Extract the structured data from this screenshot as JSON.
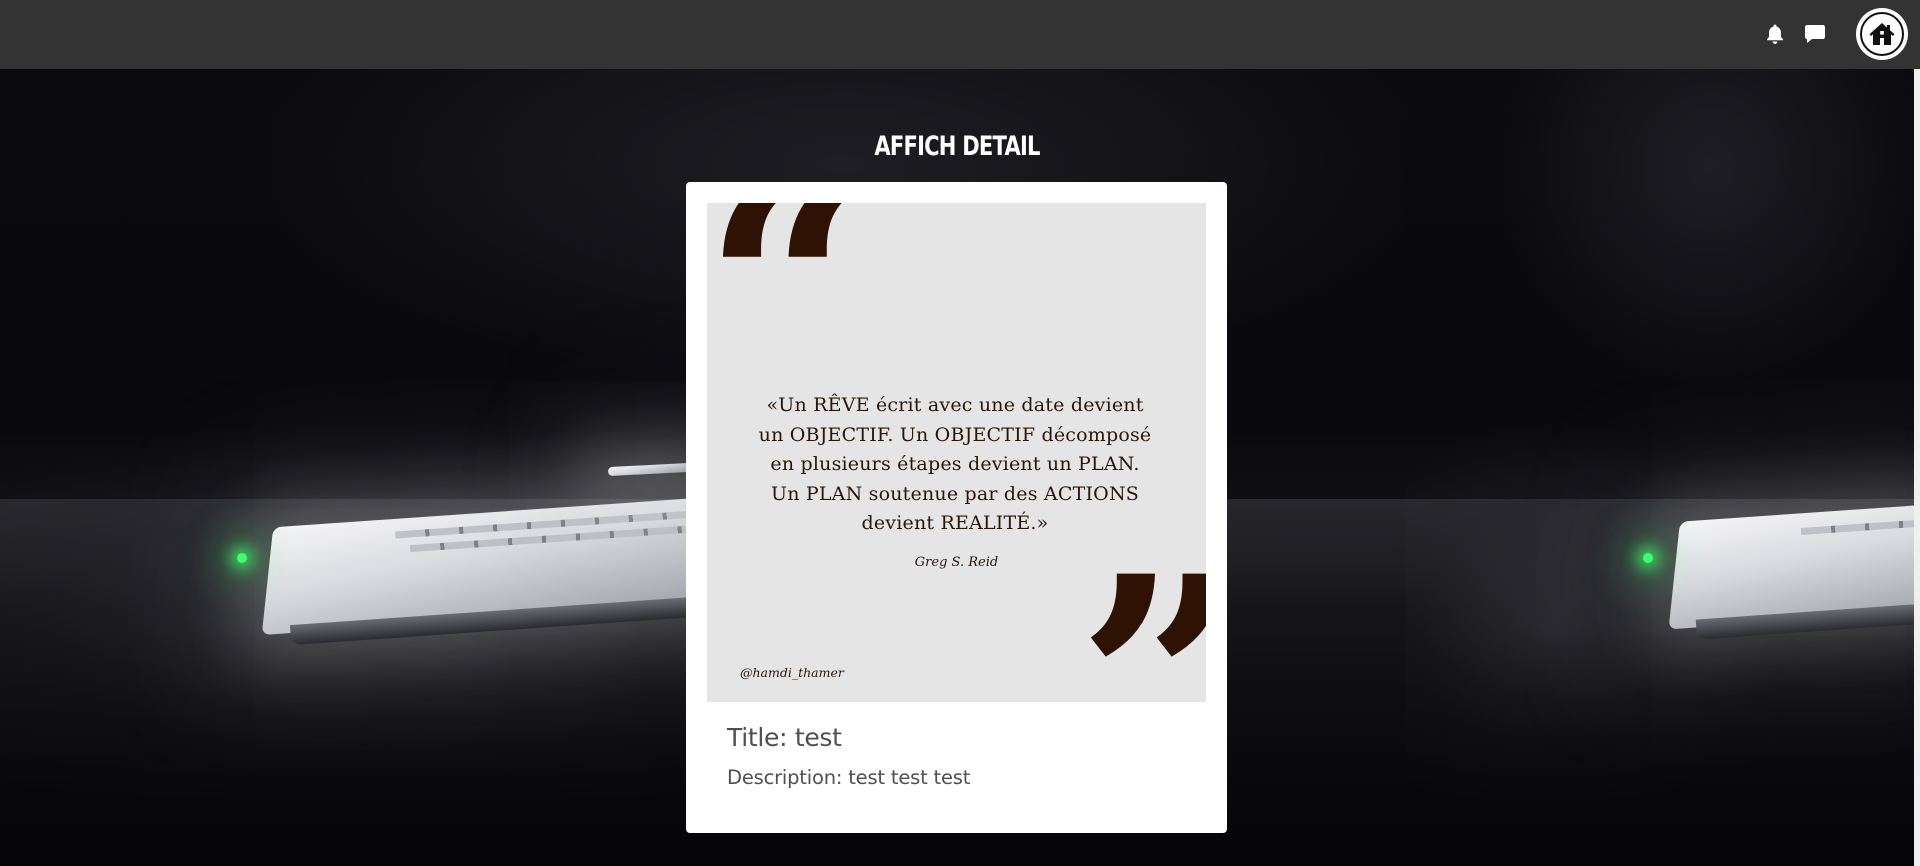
{
  "header": {
    "icons": {
      "notifications": "bell-icon",
      "messages": "chat-icon",
      "home": "home-icon"
    },
    "colors": {
      "bar": "#333333",
      "icon": "#ffffff"
    }
  },
  "page": {
    "title": "AFFICH DETAIL"
  },
  "card": {
    "image": {
      "quote": "«Un RÊVE écrit avec une date devient un OBJECTIF. Un OBJECTIF décomposé en plusieurs étapes devient un PLAN. Un PLAN soutenue par des ACTIONS devient REALITÉ.»",
      "author": "Greg S. Reid",
      "handle": "@hamdi_thamer",
      "open_mark": "“",
      "close_mark": "”",
      "quote_color": "#2e1204",
      "background": "#e5e5e5"
    },
    "title": "Title: test",
    "description": "Description: test test test"
  }
}
